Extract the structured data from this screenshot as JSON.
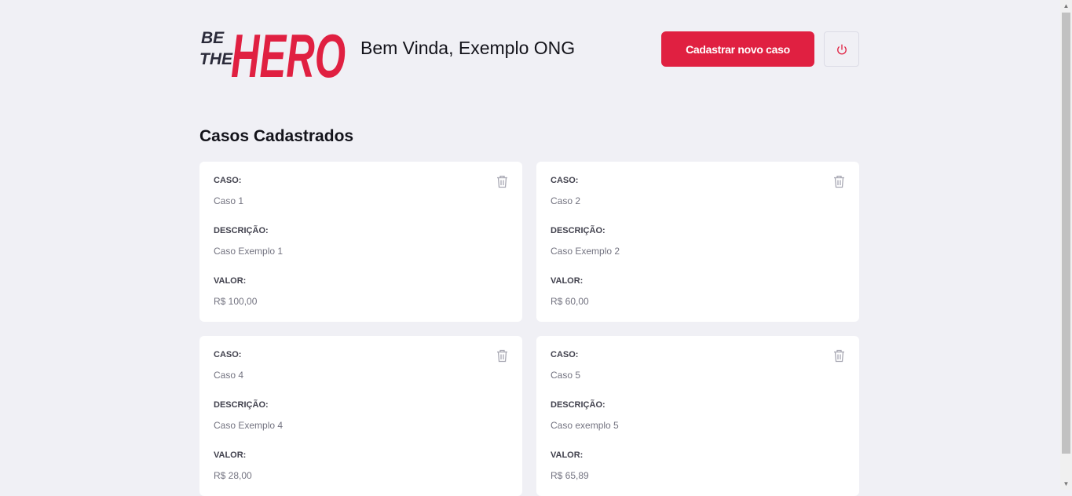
{
  "header": {
    "logo_text_small_1": "BE",
    "logo_text_small_2": "THE",
    "logo_text_big": "HERO",
    "greeting": "Bem Vinda, Exemplo ONG",
    "new_case_label": "Cadastrar novo caso"
  },
  "page_title": "Casos Cadastrados",
  "labels": {
    "case": "CASO:",
    "description": "DESCRIÇÃO:",
    "value": "VALOR:"
  },
  "cases": [
    {
      "case": "Caso 1",
      "description": "Caso Exemplo 1",
      "value": "R$ 100,00"
    },
    {
      "case": "Caso 2",
      "description": "Caso Exemplo 2",
      "value": "R$ 60,00"
    },
    {
      "case": "Caso 4",
      "description": "Caso Exemplo 4",
      "value": "R$ 28,00"
    },
    {
      "case": "Caso 5",
      "description": "Caso exemplo 5",
      "value": "R$ 65,89"
    }
  ],
  "colors": {
    "brand": "#e02041",
    "background": "#f0f0f5",
    "logo_dark": "#2b2b3a"
  },
  "icons": {
    "power": "power-icon",
    "trash": "trash-icon"
  }
}
